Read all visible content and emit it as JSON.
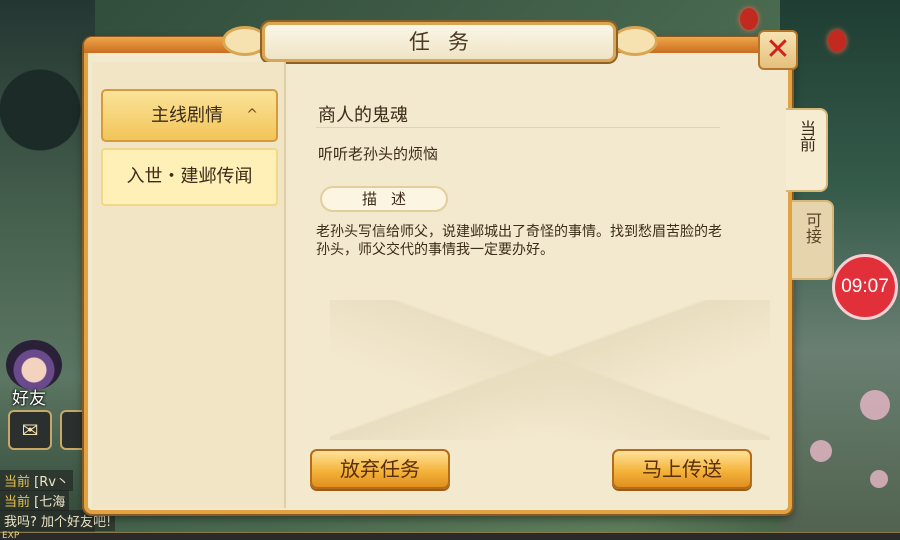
{
  "dialog": {
    "title": "任务",
    "close_icon": "close-x-icon"
  },
  "sidebar": {
    "category_label": "主线剧情",
    "category_chevron": "^",
    "quest_item_label": "入世・建邺传闻"
  },
  "quest": {
    "title": "商人的鬼魂",
    "subtitle": "听听老孙头的烦恼",
    "description_tag": "描述",
    "description": "老孙头写信给师父，说建邺城出了奇怪的事情。找到愁眉苦脸的老孙头，师父交代的事情我一定要办好。"
  },
  "buttons": {
    "abandon": "放弃任务",
    "teleport": "马上传送"
  },
  "tabs": {
    "current": "当前",
    "available": "可接"
  },
  "timer": "09:07",
  "hud": {
    "friends_label": "好友",
    "chat_icon": "chat-bubble-icon",
    "exp_label": "EXP",
    "chat_lines": [
      {
        "channel": "当前",
        "text": "[Rv丶"
      },
      {
        "channel": "当前",
        "text": "[七海"
      },
      {
        "channel": "",
        "text": "我吗? 加个好友吧!"
      }
    ]
  },
  "colors": {
    "panel_border": "#e1a244",
    "button_orange": "#f4b43c",
    "timer_red": "#e2303b",
    "close_red": "#d21f1f"
  }
}
